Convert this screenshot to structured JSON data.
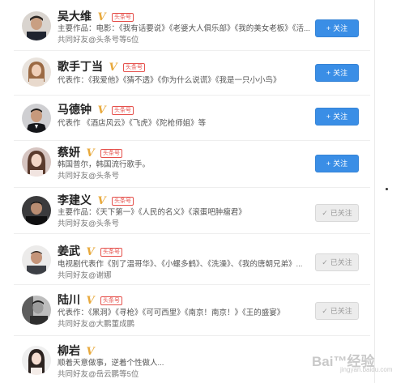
{
  "badges": {
    "verified": "V",
    "toutiao": "头条号"
  },
  "buttons": {
    "follow_icon": "+",
    "follow_label": "关注",
    "followed_icon": "✓",
    "followed_label": "已关注"
  },
  "users": [
    {
      "name": "吴大维",
      "tag": true,
      "line1": "主要作品：电影：《我有话要说》《老婆大人俱乐部》《我的美女老板》《活...",
      "line2": "共同好友@头条号等5位",
      "followed": false
    },
    {
      "name": "歌手丁当",
      "tag": true,
      "line1": "代表作：《我爱他》《猜不透》《你为什么说谎》《我是一只小小鸟》",
      "line2": "",
      "followed": false
    },
    {
      "name": "马德钟",
      "tag": true,
      "line1": "代表作 《酒店风云》《飞虎》《陀枪师姐》等",
      "line2": "",
      "followed": false
    },
    {
      "name": "蔡妍",
      "tag": true,
      "line1": "韩国普尔，韩国流行歌手。",
      "line2": "共同好友@头条号",
      "followed": false
    },
    {
      "name": "李建义",
      "tag": true,
      "line1": "主要作品：《天下第一》《人民的名义》《滚蛋吧肿瘤君》",
      "line2": "共同好友@头条号",
      "followed": true
    },
    {
      "name": "姜武",
      "tag": true,
      "line1": "电视剧代表作《別了温哥华》、《小螺多鹤》、《洗澡》、《我的唐朝兄弟》...",
      "line2": "共同好友@谢娜",
      "followed": true
    },
    {
      "name": "陆川",
      "tag": true,
      "line1": "代表作：《黑洞》《寻枪》《可可西里》《南京！南京！》《王的盛宴》",
      "line2": "共同好友@大鹏董成鹏",
      "followed": true
    },
    {
      "name": "柳岩",
      "tag": false,
      "line1": "顺着天意做事，逆着个性做人...",
      "line2": "共同好友@岳云鹏等5位",
      "followed": false
    }
  ],
  "watermark": {
    "main": "Bai™经验",
    "sub": "jingyan.baidu.com"
  },
  "colors": {
    "follow_blue": "#3a8ee6",
    "badge_gold": "#e8a93c",
    "tag_red": "#e5514c"
  }
}
